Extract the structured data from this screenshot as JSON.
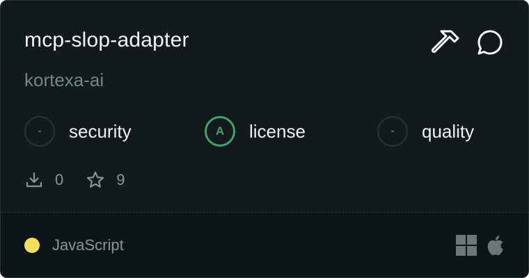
{
  "card": {
    "title": "mcp-slop-adapter",
    "owner": "kortexa-ai",
    "header_icons": [
      "hammer-icon",
      "chat-bubble-icon"
    ],
    "scores": [
      {
        "grade": "-",
        "label": "security",
        "state": "unrated"
      },
      {
        "grade": "A",
        "label": "license",
        "state": "rated"
      },
      {
        "grade": "-",
        "label": "quality",
        "state": "unrated"
      }
    ],
    "stats": {
      "downloads": "0",
      "stars": "9"
    },
    "footer": {
      "language": "JavaScript",
      "language_color": "#f1e05a",
      "platforms": [
        "windows-icon",
        "apple-icon"
      ]
    }
  },
  "colors": {
    "background": "#121a1e",
    "footer_background": "#0e1518",
    "owner_text": "#6e8a80",
    "grade_a": "#3fa66a",
    "muted_text": "#8a9498"
  }
}
